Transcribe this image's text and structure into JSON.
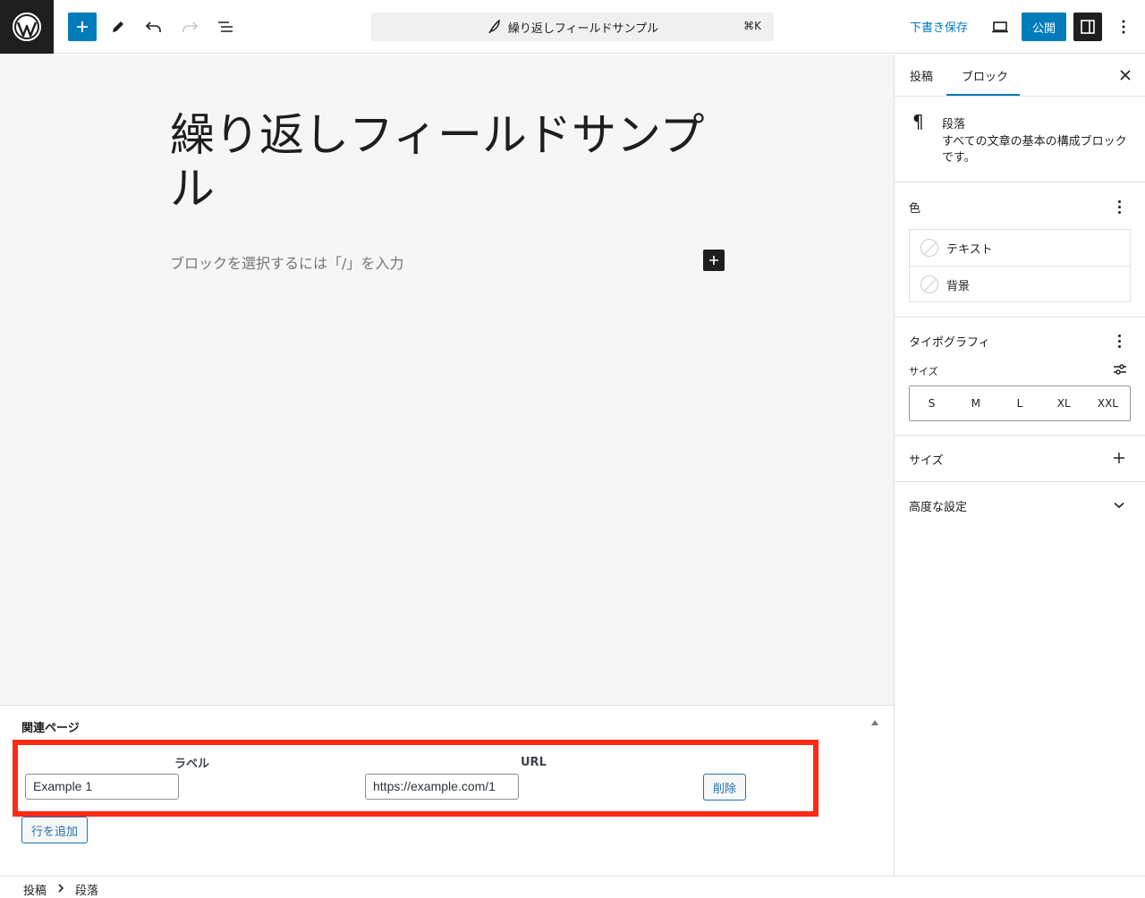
{
  "topbar": {
    "document_title": "繰り返しフィールドサンプル",
    "shortcut": "⌘K",
    "save_draft": "下書き保存",
    "publish": "公開"
  },
  "editor": {
    "post_title": "繰り返しフィールドサンプル",
    "block_placeholder": "ブロックを選択するには「/」を入力"
  },
  "metabox": {
    "title": "関連ページ",
    "col_label": "ラベル",
    "col_url": "URL",
    "rows": [
      {
        "label": "Example 1",
        "url": "https://example.com/1",
        "delete": "削除"
      }
    ],
    "add_row": "行を追加"
  },
  "footer": {
    "crumbs": [
      "投稿",
      "段落"
    ]
  },
  "sidebar": {
    "tabs": [
      "投稿",
      "ブロック"
    ],
    "active_tab": "ブロック",
    "block": {
      "name": "段落",
      "description": "すべての文章の基本の構成ブロックです。"
    },
    "color": {
      "title": "色",
      "items": [
        "テキスト",
        "背景"
      ]
    },
    "typography": {
      "title": "タイポグラフィ",
      "size_label": "サイズ",
      "sizes": [
        "S",
        "M",
        "L",
        "XL",
        "XXL"
      ]
    },
    "dimensions": {
      "title": "サイズ"
    },
    "advanced": {
      "title": "高度な設定"
    }
  },
  "colors": {
    "accent": "#007cba",
    "highlight": "#ff2a13",
    "dark": "#1e1e1e"
  }
}
